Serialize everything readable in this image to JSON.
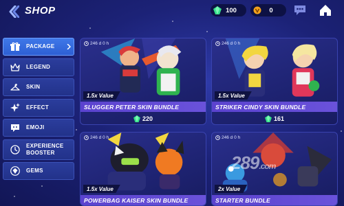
{
  "header": {
    "title": "SHOP",
    "gems": "100",
    "coins": "0"
  },
  "colors": {
    "gem": "#35e08a",
    "coin": "#f2a21c",
    "active_tab": "#3f78e8",
    "name_bar": "#5b43cf"
  },
  "sidebar": {
    "items": [
      {
        "label": "PACKAGE",
        "icon": "gift-icon"
      },
      {
        "label": "LEGEND",
        "icon": "crown-icon"
      },
      {
        "label": "SKIN",
        "icon": "hanger-icon"
      },
      {
        "label": "EFFECT",
        "icon": "sparkle-icon"
      },
      {
        "label": "EMOJI",
        "icon": "emoji-icon"
      },
      {
        "label": "EXPERIENCE BOOSTER",
        "icon": "booster-icon"
      },
      {
        "label": "GEMS",
        "icon": "gem-icon"
      }
    ]
  },
  "cards": [
    {
      "timer": "246 d 0 h",
      "value": "1.5x Value",
      "name": "SLUGGER PETER SKIN BUNDLE",
      "price": "220"
    },
    {
      "timer": "246 d 0 h",
      "value": "1.5x Value",
      "name": "STRIKER CINDY SKIN BUNDLE",
      "price": "161"
    },
    {
      "timer": "246 d 0 h",
      "value": "1.5x Value",
      "name": "POWERBAG KAISER SKIN BUNDLE"
    },
    {
      "timer": "246 d 0 h",
      "value": "2x Value",
      "name": "STARTER BUNDLE"
    }
  ],
  "watermark": {
    "main": "289",
    "suffix": ".com"
  }
}
